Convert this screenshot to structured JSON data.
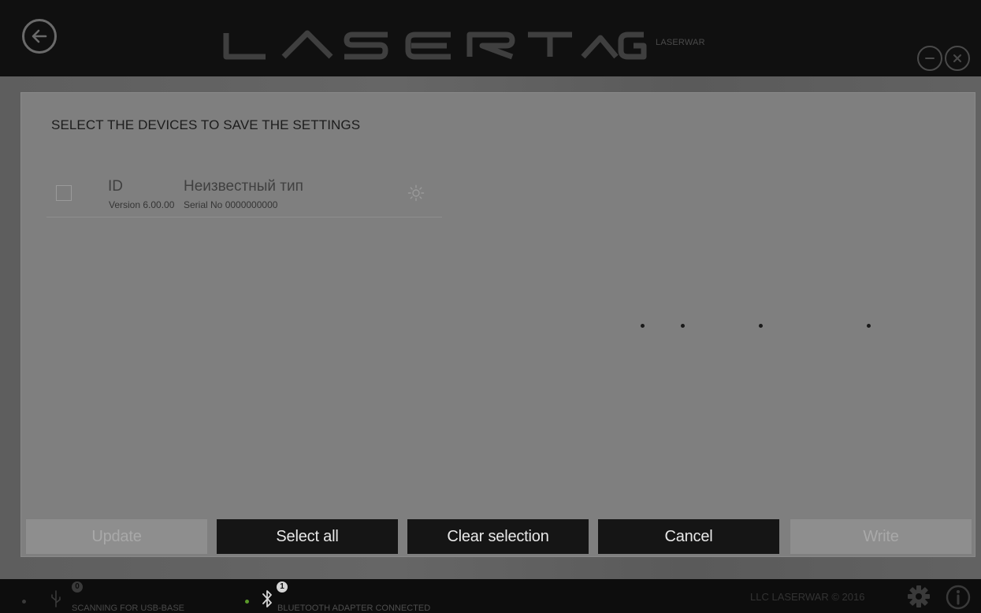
{
  "header": {
    "logo_text": "LASERTAG",
    "brand": "LASERWAR"
  },
  "dialog": {
    "title": "SELECT THE DEVICES TO SAVE THE SETTINGS",
    "devices": [
      {
        "id": "ID",
        "type": "Неизвестный тип",
        "version": "Version 6.00.00",
        "serial": "Serial No 0000000000",
        "checked": false
      }
    ],
    "buttons": {
      "update": "Update",
      "select_all": "Select all",
      "clear_selection": "Clear selection",
      "cancel": "Cancel",
      "write": "Write"
    }
  },
  "statusbar": {
    "usb_count": "0",
    "usb_status": "SCANNING FOR USB-BASE",
    "bt_count": "1",
    "bt_status": "BLUETOOTH ADAPTER CONNECTED",
    "copyright": "LLC LASERWAR © 2016"
  },
  "colors": {
    "header_bg": "#101010",
    "dialog_bg": "#7f7f7f",
    "button_dark": "#151515",
    "button_disabled": "#8e8e8e",
    "status_ok": "#5a9a2a",
    "status_idle": "#3a3a3a"
  },
  "icons": {
    "back": "back-arrow-icon",
    "minimize": "minimize-icon",
    "close": "close-icon",
    "device_light": "sun-icon",
    "usb": "usb-icon",
    "bluetooth": "bluetooth-icon",
    "settings": "gear-icon",
    "info": "info-icon"
  }
}
